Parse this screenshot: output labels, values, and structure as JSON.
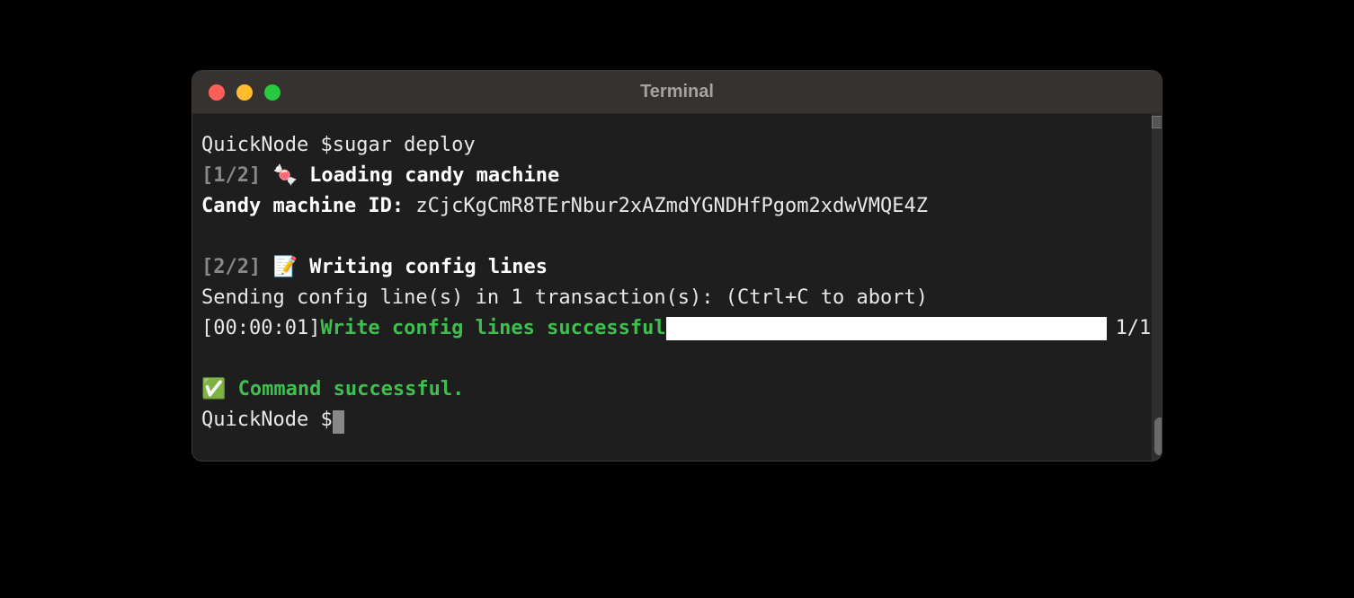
{
  "window": {
    "title": "Terminal"
  },
  "prompt1": "QuickNode $",
  "command": "sugar deploy",
  "step1": {
    "tag": "[1/2]",
    "icon": "🍬",
    "text": "Loading candy machine"
  },
  "machine_label": "Candy machine ID:",
  "machine_id": "zCjcKgCmR8TErNbur2xAZmdYGNDHfPgom2xdwVMQE4Z",
  "step2": {
    "tag": "[2/2]",
    "icon": "📝",
    "text": "Writing config lines"
  },
  "sending": "Sending config line(s) in 1 transaction(s): (Ctrl+C to abort)",
  "elapsed": "[00:00:01]",
  "progress_msg": "Write config lines successful",
  "progress_count": "1/1",
  "success_icon": "✅",
  "success_text": "Command successful.",
  "prompt2": "QuickNode $"
}
